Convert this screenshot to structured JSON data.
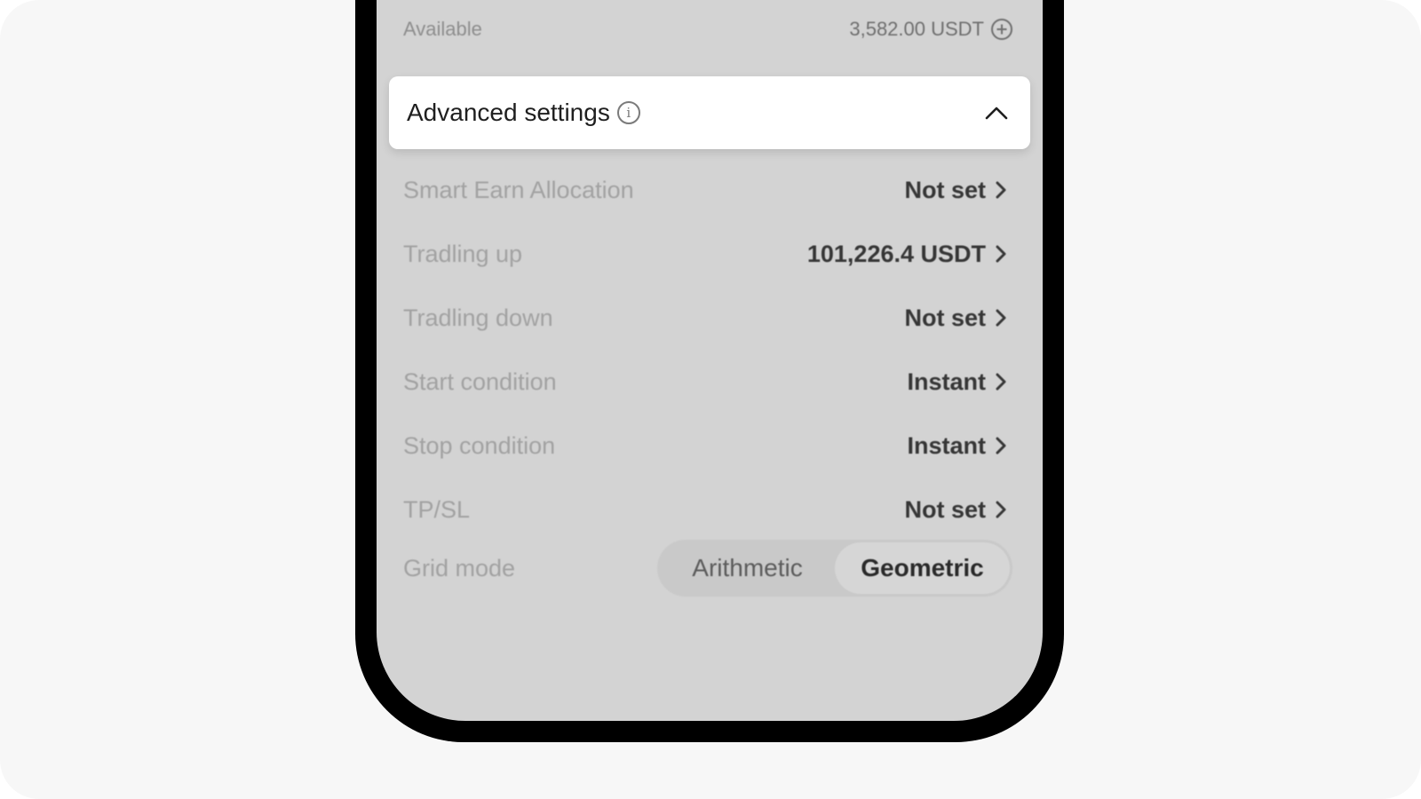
{
  "available": {
    "label": "Available",
    "value": "3,582.00 USDT"
  },
  "advanced": {
    "title": "Advanced settings",
    "info_glyph": "i",
    "expanded": true
  },
  "settings": [
    {
      "label": "Smart Earn Allocation",
      "value": "Not set"
    },
    {
      "label": "Tradling up",
      "value": "101,226.4 USDT"
    },
    {
      "label": "Tradling down",
      "value": "Not set"
    },
    {
      "label": "Start condition",
      "value": "Instant"
    },
    {
      "label": "Stop condition",
      "value": "Instant"
    },
    {
      "label": "TP/SL",
      "value": "Not set"
    }
  ],
  "grid_mode": {
    "label": "Grid mode",
    "options": [
      "Arithmetic",
      "Geometric"
    ],
    "selected": "Geometric"
  },
  "colors": {
    "overlay": "#d3d3d3",
    "card": "#ffffff",
    "frame": "#000000"
  }
}
